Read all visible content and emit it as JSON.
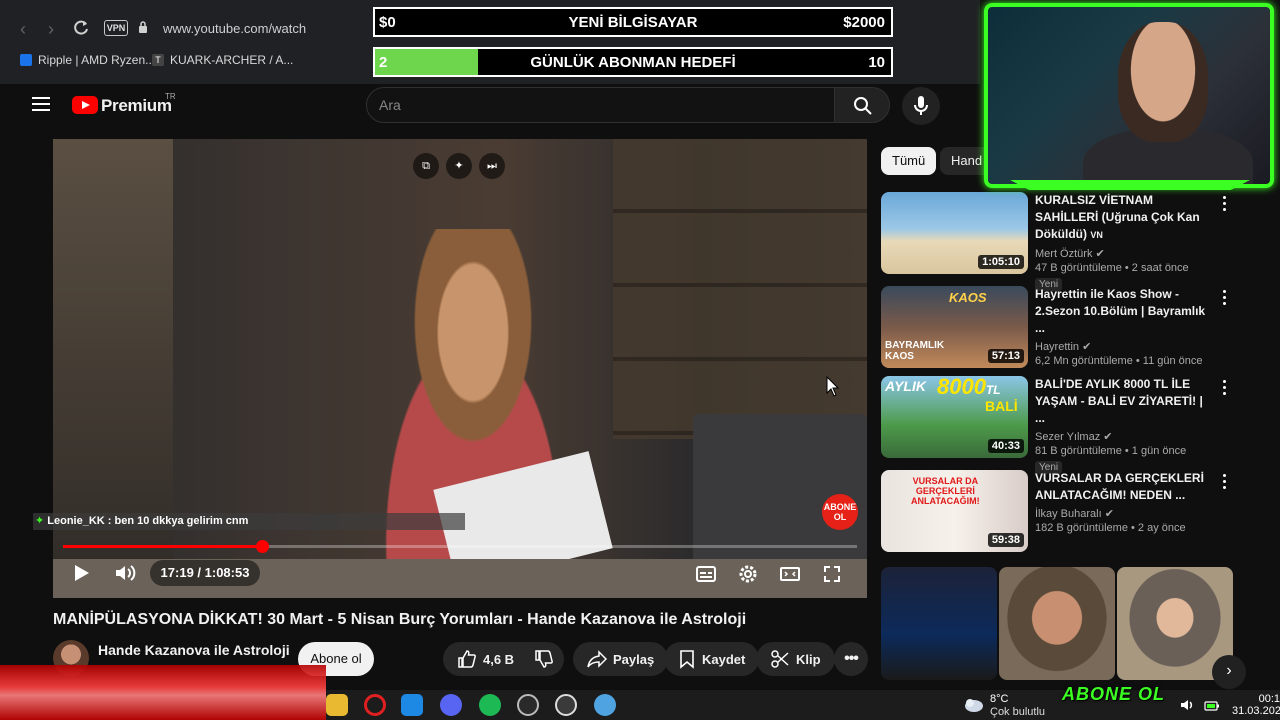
{
  "browser": {
    "url": "www.youtube.com/watch",
    "vpn_label": "VPN",
    "bookmarks": [
      "Ripple | AMD Ryzen...",
      "KUARK-ARCHER / A..."
    ]
  },
  "overlay": {
    "goal1": {
      "left": "$0",
      "center": "YENİ BİLGİSAYAR",
      "right": "$2000"
    },
    "goal2": {
      "left": "2",
      "center": "GÜNLÜK ABONMAN HEDEFİ",
      "right": "10",
      "progress": 0.2
    },
    "abone_ol": "ABONE OL"
  },
  "yt": {
    "brand": "Premium",
    "region": "TR",
    "search_placeholder": "Ara"
  },
  "player": {
    "chat_user": "Leonie_KK",
    "chat_message": " : ben 10 dkkya gelirim cnm",
    "time": "17:19 / 1:08:53",
    "progress": 0.251,
    "abone_bubble": "ABONE OL",
    "accent": "#ff0000"
  },
  "video": {
    "title": "MANİPÜLASYONA DİKKAT! 30 Mart - 5 Nisan Burç Yorumları - Hande Kazanova ile Astroloji",
    "channel": "Hande Kazanova ile Astroloji",
    "subscribe": "Abone ol",
    "likes": "4,6 B",
    "share": "Paylaş",
    "save": "Kaydet",
    "clip": "Klip"
  },
  "sidebar": {
    "chips": [
      "Tümü",
      "Hand"
    ],
    "recs": [
      {
        "title": "KURALSIZ VİETNAM SAHİLLERİ (Uğruna Çok Kan Döküldü)",
        "suffix": "VN",
        "channel": "Mert Öztürk",
        "stats": "47 B görüntüleme • 2 saat önce",
        "badge": "Yeni",
        "duration": "1:05:10"
      },
      {
        "title": "Hayrettin ile Kaos Show - 2.Sezon 10.Bölüm | Bayramlık ...",
        "suffix": "",
        "channel": "Hayrettin",
        "stats": "6,2 Mn görüntüleme • 11 gün önce",
        "badge": "",
        "duration": "57:13"
      },
      {
        "title": "BALİ'DE AYLIK 8000 TL İLE YAŞAM - BALİ EV ZİYARETİ! | ...",
        "suffix": "",
        "channel": "Sezer Yılmaz",
        "stats": "81 B görüntüleme • 1 gün önce",
        "badge": "Yeni",
        "duration": "40:33"
      },
      {
        "title": "VURSALAR DA GERÇEKLERİ ANLATACAĞIM! NEDEN ...",
        "suffix": "",
        "channel": "İlkay Buharalı",
        "stats": "182 B görüntüleme • 2 ay önce",
        "badge": "",
        "duration": "59:38"
      }
    ]
  },
  "taskbar": {
    "temp": "8°C",
    "weather": "Çok bulutlu",
    "time": "00:1",
    "date": "31.03.202"
  }
}
